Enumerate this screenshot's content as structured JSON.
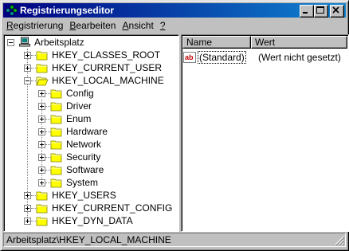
{
  "window": {
    "title": "Registrierungseditor"
  },
  "menu": {
    "items": [
      {
        "label": "Registrierung",
        "accel": "R"
      },
      {
        "label": "Bearbeiten",
        "accel": "B"
      },
      {
        "label": "Ansicht",
        "accel": "A"
      },
      {
        "label": "?",
        "accel": "?"
      }
    ]
  },
  "tree": {
    "root": "Arbeitsplatz",
    "hives": [
      "HKEY_CLASSES_ROOT",
      "HKEY_CURRENT_USER",
      "HKEY_LOCAL_MACHINE",
      "HKEY_USERS",
      "HKEY_CURRENT_CONFIG",
      "HKEY_DYN_DATA"
    ],
    "local_machine_children": [
      "Config",
      "Driver",
      "Enum",
      "Hardware",
      "Network",
      "Security",
      "Software",
      "System"
    ]
  },
  "list": {
    "columns": [
      "Name",
      "Wert"
    ],
    "rows": [
      {
        "name": "(Standard)",
        "value": "(Wert nicht gesetzt)",
        "icon": "string-value-icon"
      }
    ]
  },
  "status": {
    "path": "Arbeitsplatz\\HKEY_LOCAL_MACHINE"
  },
  "colors": {
    "titlebar_start": "#000080",
    "titlebar_end": "#1084d0",
    "face": "#c0c0c0"
  }
}
